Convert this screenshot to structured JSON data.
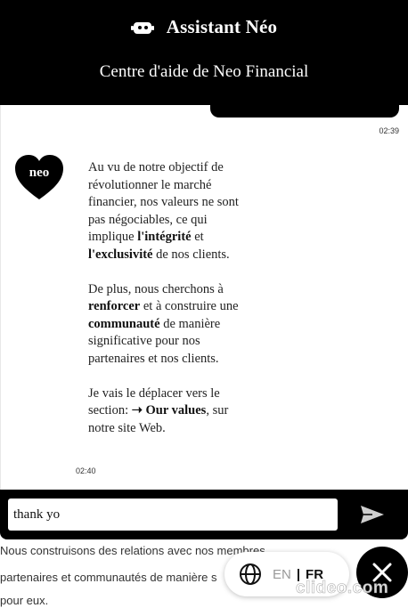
{
  "header": {
    "title": "Assistant Néo",
    "subtitle": "Centre d'aide de Neo Financial"
  },
  "chat": {
    "user_timestamp": "02:39",
    "bot_avatar_text": "neo",
    "bot_paragraphs": {
      "p1": {
        "t1": "Au vu de notre objectif de révolutionner le marché financier, nos valeurs ne sont pas négociables, ce qui implique ",
        "b1": "l'intégrité",
        "t2": " et ",
        "b2": "l'exclusivité",
        "t3": " de nos clients."
      },
      "p2": {
        "t1": "De plus, nous cherchons à ",
        "b1": "renforcer",
        "t2": " et à construire une ",
        "b2": "communauté",
        "t3": " de manière significative pour nos partenaires et nos clients."
      },
      "p3": {
        "t1": "Je vais le déplacer vers le section: ",
        "b1": "➝ Our values",
        "t2": ", sur notre site Web."
      }
    },
    "bot_timestamp": "02:40"
  },
  "input": {
    "value": "thank yo"
  },
  "page_content": {
    "line1": "Nous construisons des relations avec nos membres,",
    "line2": "partenaires et communautés de manière s",
    "line3": "pour eux."
  },
  "language": {
    "en": "EN",
    "separator": "|",
    "fr": "FR"
  },
  "watermark": "clideo.com"
}
